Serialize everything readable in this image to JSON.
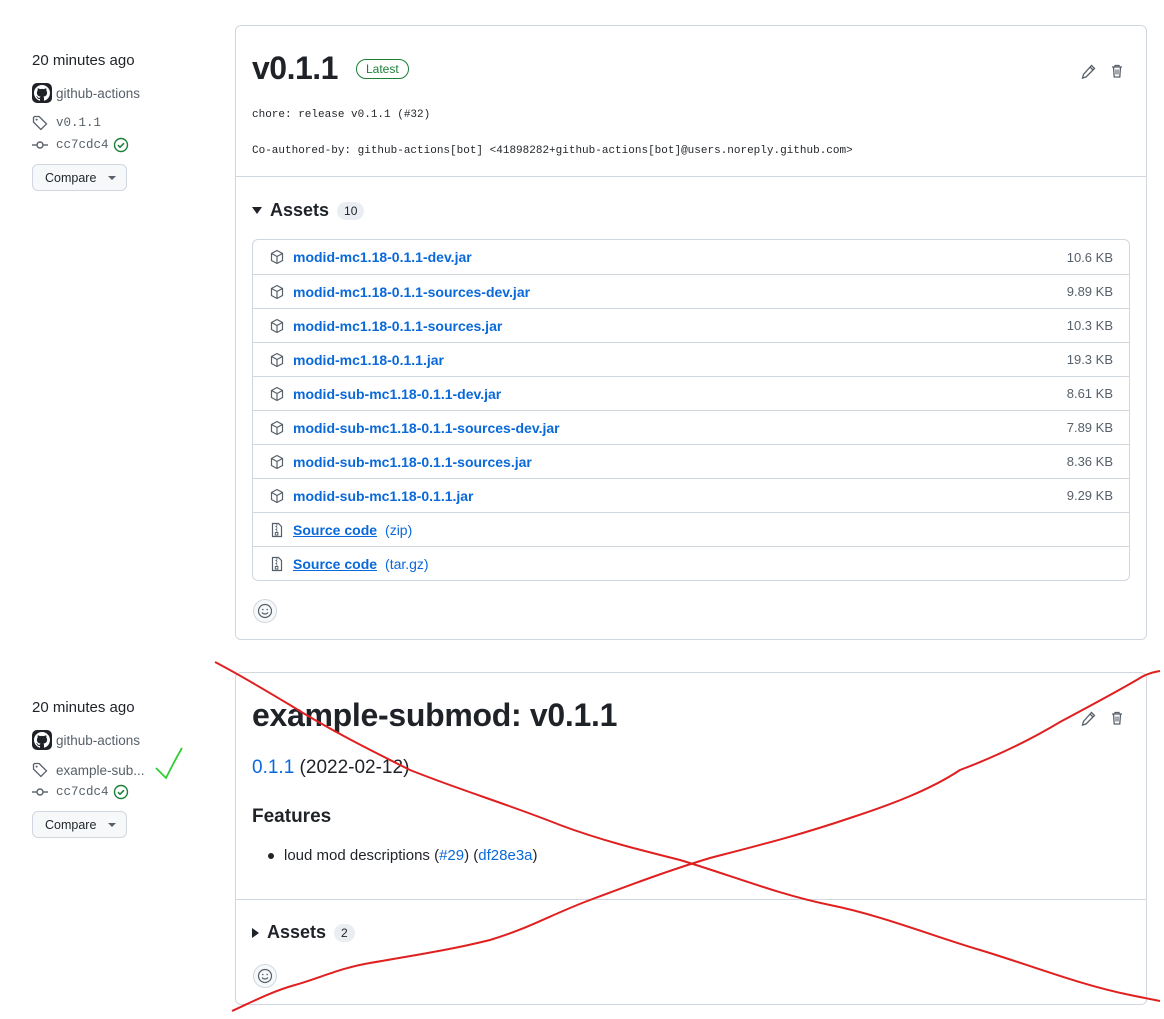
{
  "releases": [
    {
      "sidebar": {
        "time": "20 minutes ago",
        "author": "github-actions",
        "tag": "v0.1.1",
        "commit": "cc7cdc4",
        "compare_label": "Compare"
      },
      "title": "v0.1.1",
      "badge": "Latest",
      "body_lines": [
        "chore: release v0.1.1 (#32)",
        "Co-authored-by: github-actions[bot] <41898282+github-actions[bot]@users.noreply.github.com>"
      ],
      "assets_label": "Assets",
      "assets_count": "10",
      "assets": [
        {
          "name": "modid-mc1.18-0.1.1-dev.jar",
          "size": "10.6 KB"
        },
        {
          "name": "modid-mc1.18-0.1.1-sources-dev.jar",
          "size": "9.89 KB"
        },
        {
          "name": "modid-mc1.18-0.1.1-sources.jar",
          "size": "10.3 KB"
        },
        {
          "name": "modid-mc1.18-0.1.1.jar",
          "size": "19.3 KB"
        },
        {
          "name": "modid-sub-mc1.18-0.1.1-dev.jar",
          "size": "8.61 KB"
        },
        {
          "name": "modid-sub-mc1.18-0.1.1-sources-dev.jar",
          "size": "7.89 KB"
        },
        {
          "name": "modid-sub-mc1.18-0.1.1-sources.jar",
          "size": "8.36 KB"
        },
        {
          "name": "modid-sub-mc1.18-0.1.1.jar",
          "size": "9.29 KB"
        }
      ],
      "source_code": [
        {
          "label": "Source code",
          "ext": "(zip)"
        },
        {
          "label": "Source code",
          "ext": "(tar.gz)"
        }
      ]
    },
    {
      "sidebar": {
        "time": "20 minutes ago",
        "author": "github-actions",
        "tag": "example-sub...",
        "commit": "cc7cdc4",
        "compare_label": "Compare"
      },
      "title": "example-submod: v0.1.1",
      "version_link": "0.1.1",
      "version_date": "(2022-02-12)",
      "features_heading": "Features",
      "feature_text": "loud mod descriptions (",
      "feature_pr": "#29",
      "feature_mid": ") (",
      "feature_commit": "df28e3a",
      "feature_end": ")",
      "assets_label": "Assets",
      "assets_count": "2"
    }
  ],
  "annotations": {
    "strike_color": "#e02020",
    "check_color": "#33cc33"
  },
  "icons": {
    "avatar": "github-mark-icon",
    "tag": "tag-icon",
    "commit": "git-commit-icon",
    "verified": "verified-check-icon",
    "edit": "pencil-icon",
    "delete": "trash-icon",
    "package": "package-icon",
    "zip": "file-zip-icon",
    "reaction": "smiley-icon"
  }
}
